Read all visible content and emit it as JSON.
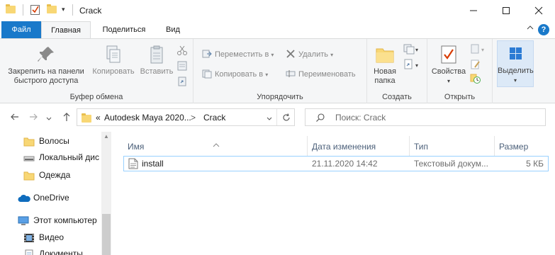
{
  "window": {
    "title": "Crack",
    "minimize": "—",
    "maximize": "☐",
    "close": "✕"
  },
  "tabs": {
    "file": "Файл",
    "home": "Главная",
    "share": "Поделиться",
    "view": "Вид",
    "help": "?"
  },
  "ribbon": {
    "clipboard": {
      "label": "Буфер обмена",
      "pin": "Закрепить на панели быстрого доступа",
      "copy": "Копировать",
      "paste": "Вставить"
    },
    "organize": {
      "label": "Упорядочить",
      "move_to": "Переместить в",
      "copy_to": "Копировать в",
      "delete": "Удалить",
      "rename": "Переименовать"
    },
    "new": {
      "label": "Создать",
      "new_folder": "Новая папка"
    },
    "open": {
      "label": "Открыть",
      "properties": "Свойства"
    },
    "select": {
      "label": "Выделить"
    }
  },
  "address": {
    "prefix": "«",
    "segment1": "Autodesk Maya 2020...",
    "sep": ">",
    "segment2": "Crack",
    "search_placeholder": "Поиск: Crack"
  },
  "nav": {
    "items": [
      {
        "label": "Волосы",
        "icon": "folder-icon"
      },
      {
        "label": "Локальный дис",
        "icon": "drive-icon"
      },
      {
        "label": "Одежда",
        "icon": "folder-icon"
      },
      {
        "label": "OneDrive",
        "icon": "cloud-icon"
      },
      {
        "label": "Этот компьютер",
        "icon": "computer-icon"
      },
      {
        "label": "Видео",
        "icon": "video-icon"
      },
      {
        "label": "Документы",
        "icon": "documents-icon"
      }
    ]
  },
  "columns": {
    "name": "Имя",
    "date": "Дата изменения",
    "type": "Тип",
    "size": "Размер"
  },
  "files": [
    {
      "name": "install",
      "date": "21.11.2020 14:42",
      "type": "Текстовый докум...",
      "size": "5 КБ"
    }
  ]
}
